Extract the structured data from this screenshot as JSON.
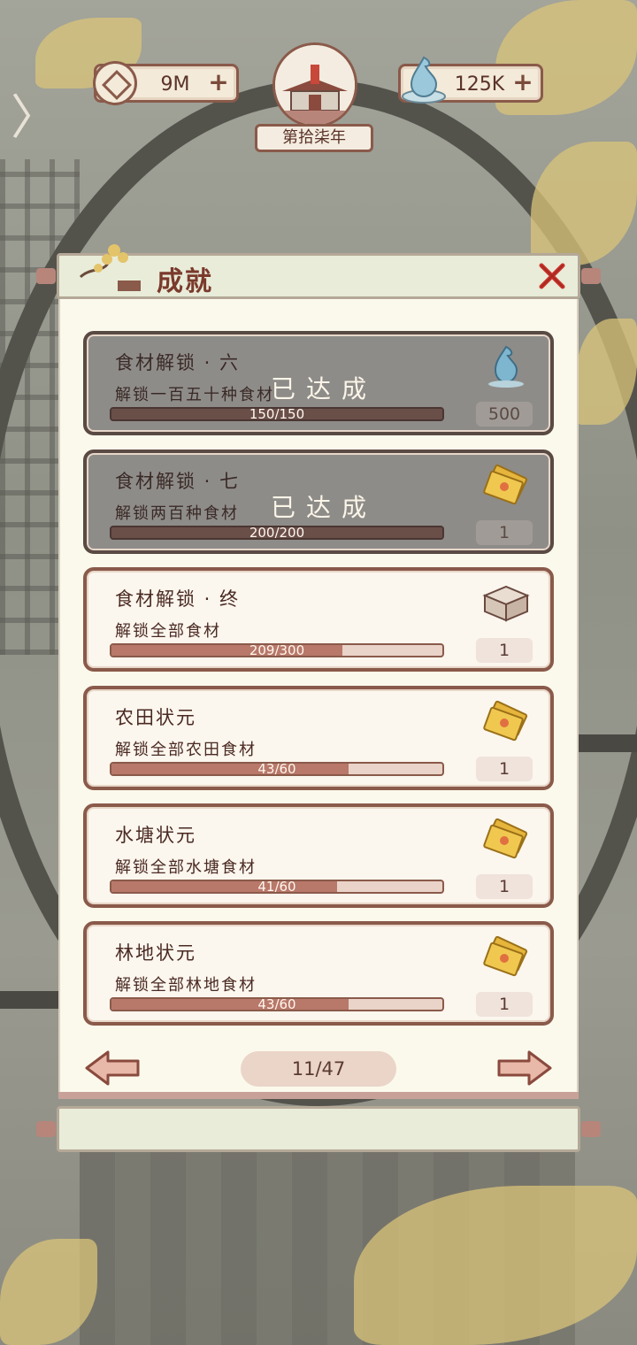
{
  "hud": {
    "coins": "9M",
    "water": "125K",
    "year_label": "第拾柒年"
  },
  "panel": {
    "title": "成就"
  },
  "achievements": [
    {
      "name": "食材解锁 · 六",
      "desc": "解锁一百五十种食材",
      "progress_text": "150/150",
      "progress": 1.0,
      "completed": true,
      "completed_text": "已达成",
      "reward_icon": "water-drop-icon",
      "reward_amount": "500"
    },
    {
      "name": "食材解锁 · 七",
      "desc": "解锁两百种食材",
      "progress_text": "200/200",
      "progress": 1.0,
      "completed": true,
      "completed_text": "已达成",
      "reward_icon": "ticket-icon",
      "reward_amount": "1"
    },
    {
      "name": "食材解锁 · 终",
      "desc": "解锁全部食材",
      "progress_text": "209/300",
      "progress": 0.697,
      "completed": false,
      "reward_icon": "box-icon",
      "reward_amount": "1"
    },
    {
      "name": "农田状元",
      "desc": "解锁全部农田食材",
      "progress_text": "43/60",
      "progress": 0.717,
      "completed": false,
      "reward_icon": "ticket-icon",
      "reward_amount": "1"
    },
    {
      "name": "水塘状元",
      "desc": "解锁全部水塘食材",
      "progress_text": "41/60",
      "progress": 0.683,
      "completed": false,
      "reward_icon": "ticket-icon",
      "reward_amount": "1"
    },
    {
      "name": "林地状元",
      "desc": "解锁全部林地食材",
      "progress_text": "43/60",
      "progress": 0.717,
      "completed": false,
      "reward_icon": "ticket-icon",
      "reward_amount": "1"
    }
  ],
  "pager": {
    "page_text": "11/47"
  },
  "colors": {
    "accent": "#8a5a4a",
    "progress_fill": "#b8786a",
    "panel_bg": "#fbf9ec"
  }
}
